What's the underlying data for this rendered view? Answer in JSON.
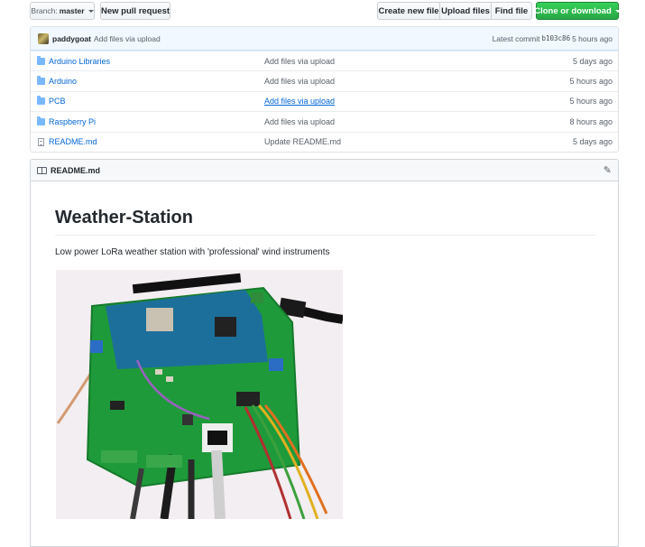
{
  "toolbar": {
    "branch_prefix": "Branch:",
    "branch_name": "master",
    "new_pr": "New pull request",
    "create_file": "Create new file",
    "upload_files": "Upload files",
    "find_file": "Find file",
    "clone": "Clone or download"
  },
  "commit": {
    "author": "paddygoat",
    "message": "Add files via upload",
    "latest_label": "Latest commit",
    "sha": "b103c86",
    "age": "5 hours ago"
  },
  "files": [
    {
      "name": "Arduino Libraries",
      "message": "Add files via upload",
      "age": "5 days ago",
      "type": "folder"
    },
    {
      "name": "Arduino",
      "message": "Add files via upload",
      "age": "5 hours ago",
      "type": "folder"
    },
    {
      "name": "PCB",
      "message": "Add files via upload",
      "age": "5 hours ago",
      "type": "folder"
    },
    {
      "name": "Raspberry Pi",
      "message": "Add files via upload",
      "age": "8 hours ago",
      "type": "folder"
    },
    {
      "name": "README.md",
      "message": "Update README.md",
      "age": "5 days ago",
      "type": "file"
    }
  ],
  "readme": {
    "filename": "README.md",
    "title": "Weather-Station",
    "description": "Low power LoRa weather station with 'professional' wind instruments"
  },
  "colors": {
    "accent_green": "#28a745",
    "link_blue": "#0366d6",
    "pcb_green": "#1f9a3a"
  }
}
